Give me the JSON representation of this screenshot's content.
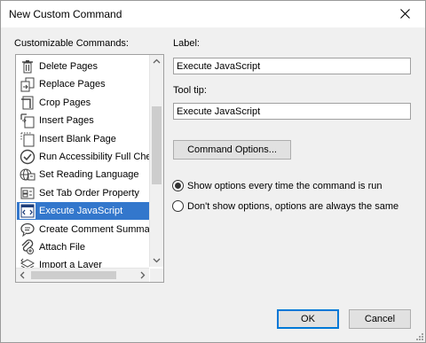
{
  "window": {
    "title": "New Custom Command"
  },
  "commands": {
    "heading": "Customizable Commands:",
    "items": [
      {
        "label": "Delete Pages",
        "icon": "trash-icon",
        "selected": false
      },
      {
        "label": "Replace Pages",
        "icon": "replace-pages-icon",
        "selected": false
      },
      {
        "label": "Crop Pages",
        "icon": "crop-icon",
        "selected": false
      },
      {
        "label": "Insert Pages",
        "icon": "insert-pages-icon",
        "selected": false
      },
      {
        "label": "Insert Blank Page",
        "icon": "blank-page-icon",
        "selected": false
      },
      {
        "label": "Run Accessibility Full Check",
        "icon": "check-circle-icon",
        "selected": false
      },
      {
        "label": "Set Reading Language",
        "icon": "language-icon",
        "selected": false
      },
      {
        "label": "Set Tab Order Property",
        "icon": "tab-order-icon",
        "selected": false
      },
      {
        "label": "Execute JavaScript",
        "icon": "javascript-icon",
        "selected": true
      },
      {
        "label": "Create Comment Summary",
        "icon": "comment-summary-icon",
        "selected": false
      },
      {
        "label": "Attach File",
        "icon": "attach-file-icon",
        "selected": false
      },
      {
        "label": "Import a Layer",
        "icon": "layer-icon",
        "selected": false
      }
    ]
  },
  "form": {
    "label_caption": "Label:",
    "label_value": "Execute JavaScript",
    "tooltip_caption": "Tool tip:",
    "tooltip_value": "Execute JavaScript",
    "command_options_button": "Command Options..."
  },
  "options": {
    "show_every_time": "Show options every time the command is run",
    "dont_show": "Don't show options, options are always the same",
    "selected": "show_every_time"
  },
  "footer": {
    "ok_label": "OK",
    "cancel_label": "Cancel"
  },
  "colors": {
    "selection": "#3377cc",
    "default_button_border": "#0078d7",
    "dialog_background": "#f0f0f0"
  }
}
